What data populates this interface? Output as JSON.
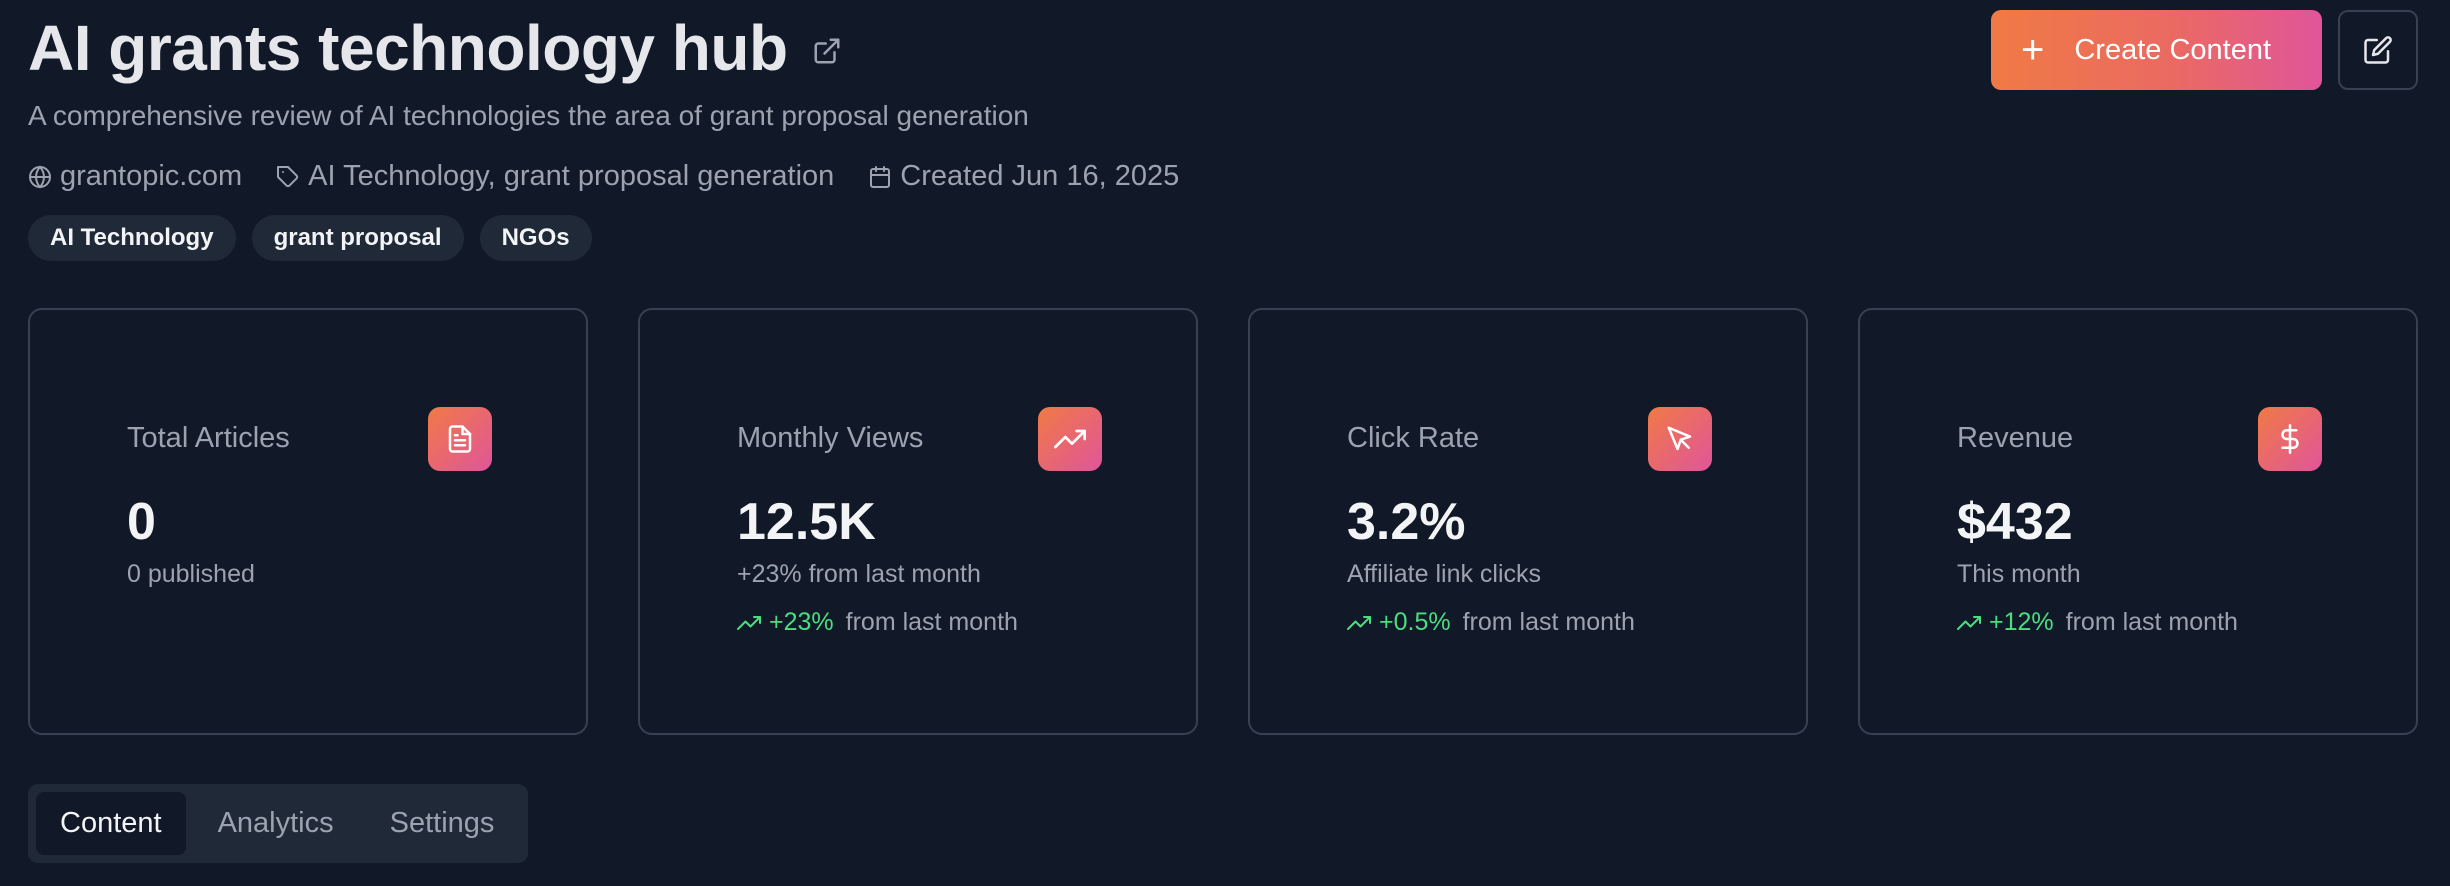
{
  "header": {
    "title": "AI grants technology hub",
    "subtitle": "A comprehensive review of AI technologies the area of grant proposal generation",
    "meta": {
      "domain": "grantopic.com",
      "categories": "AI Technology, grant proposal generation",
      "created": "Created Jun 16, 2025"
    },
    "tags": [
      "AI Technology",
      "grant proposal",
      "NGOs"
    ]
  },
  "actions": {
    "create_label": "Create Content"
  },
  "stats": [
    {
      "label": "Total Articles",
      "value": "0",
      "sub": "0 published",
      "icon": "document-icon",
      "trend_value": "",
      "trend_text": ""
    },
    {
      "label": "Monthly Views",
      "value": "12.5K",
      "sub": "+23% from last month",
      "icon": "trending-up-icon",
      "trend_value": "+23%",
      "trend_text": "from last month"
    },
    {
      "label": "Click Rate",
      "value": "3.2%",
      "sub": "Affiliate link clicks",
      "icon": "cursor-icon",
      "trend_value": "+0.5%",
      "trend_text": "from last month"
    },
    {
      "label": "Revenue",
      "value": "$432",
      "sub": "This month",
      "icon": "dollar-icon",
      "trend_value": "+12%",
      "trend_text": "from last month"
    }
  ],
  "tabs": [
    {
      "label": "Content",
      "active": true
    },
    {
      "label": "Analytics",
      "active": false
    },
    {
      "label": "Settings",
      "active": false
    }
  ],
  "colors": {
    "background": "#111827",
    "accent_start": "#f07a45",
    "accent_end": "#e0559a",
    "positive": "#4ade80"
  }
}
